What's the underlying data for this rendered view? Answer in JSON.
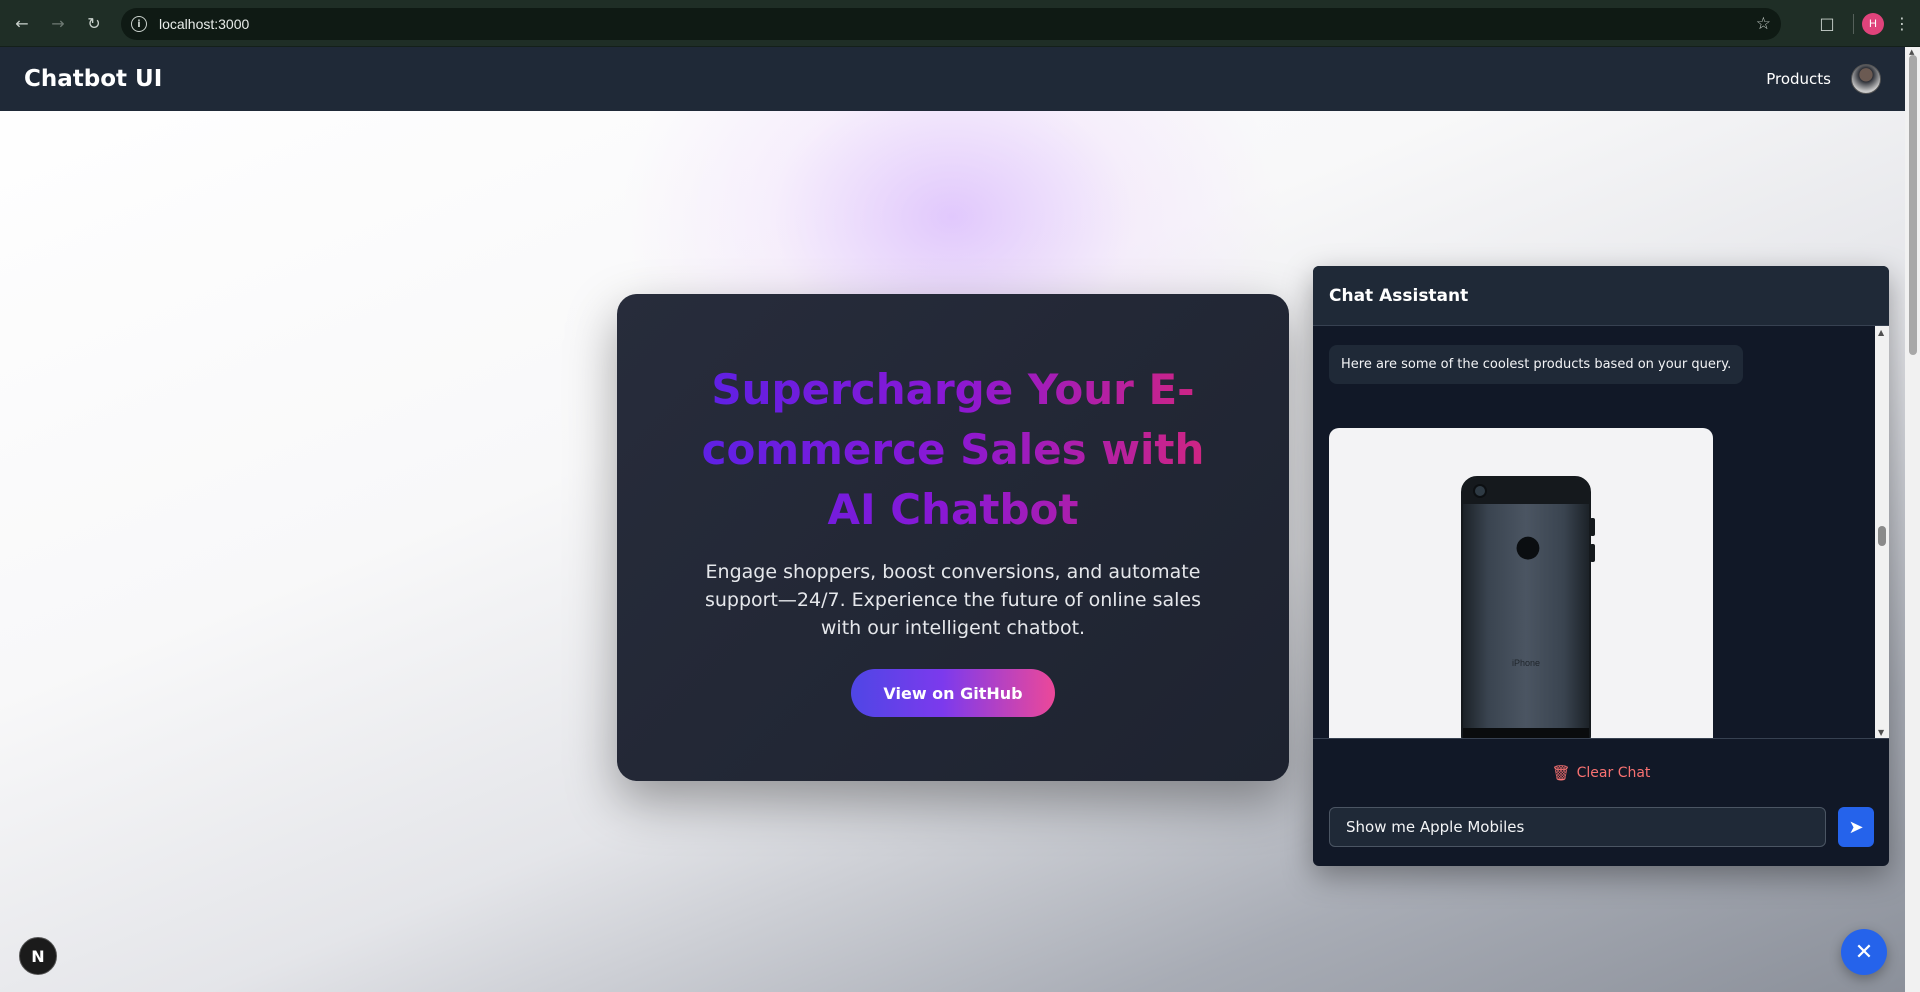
{
  "browser": {
    "url": "localhost:3000",
    "profile_initial": "H",
    "icons": {
      "back": "back-arrow-icon",
      "forward": "forward-arrow-icon",
      "reload": "reload-icon",
      "info": "site-info-icon",
      "bookmark": "star-icon",
      "extensions": "puzzle-icon",
      "menu": "kebab-menu-icon"
    }
  },
  "header": {
    "title": "Chatbot UI",
    "products_link": "Products"
  },
  "hero": {
    "title": "Supercharge Your E-commerce Sales with AI Chatbot",
    "subtitle": "Engage shoppers, boost conversions, and automate support—24/7. Experience the future of online sales with our intelligent chatbot.",
    "button_label": "View on GitHub"
  },
  "chat": {
    "title": "Chat Assistant",
    "messages": [
      {
        "role": "bot",
        "text": "Here are some of the coolest products based on your query."
      }
    ],
    "product_image_text": "iPhone",
    "clear_label": "Clear Chat",
    "input_value": "Show me Apple Mobiles"
  },
  "next_badge": "N",
  "colors": {
    "header_bg": "#1f2937",
    "chat_bg": "#111827",
    "accent_blue": "#2563eb",
    "clear_red": "#f87171",
    "gradient_start": "#5b21e6",
    "gradient_end": "#d4267d"
  }
}
